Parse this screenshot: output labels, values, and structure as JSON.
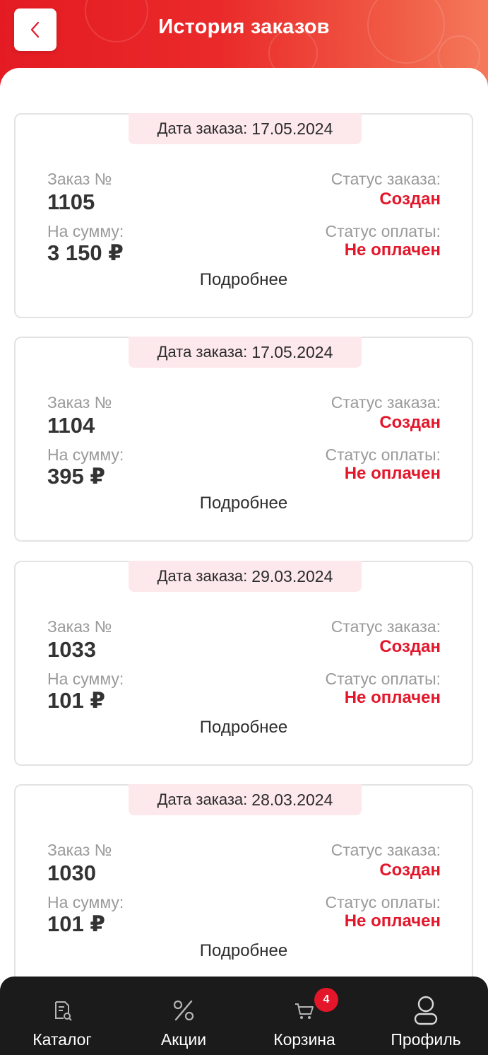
{
  "header": {
    "title": "История заказов"
  },
  "labels": {
    "date_prefix": "Дата заказа:",
    "order_no": "Заказ №",
    "amount": "На сумму:",
    "order_status": "Статус заказа:",
    "payment_status": "Статус оплаты:",
    "details": "Подробнее"
  },
  "orders": [
    {
      "date": "17.05.2024",
      "number": "1105",
      "amount": "3 150 ₽",
      "status": "Создан",
      "payment": "Не оплачен"
    },
    {
      "date": "17.05.2024",
      "number": "1104",
      "amount": "395 ₽",
      "status": "Создан",
      "payment": "Не оплачен"
    },
    {
      "date": "29.03.2024",
      "number": "1033",
      "amount": "101 ₽",
      "status": "Создан",
      "payment": "Не оплачен"
    },
    {
      "date": "28.03.2024",
      "number": "1030",
      "amount": "101 ₽",
      "status": "Создан",
      "payment": "Не оплачен"
    }
  ],
  "tabbar": {
    "items": [
      {
        "label": "Каталог",
        "icon": "catalog-icon"
      },
      {
        "label": "Акции",
        "icon": "percent-icon"
      },
      {
        "label": "Корзина",
        "icon": "cart-icon",
        "badge": "4"
      },
      {
        "label": "Профиль",
        "icon": "profile-icon"
      }
    ]
  },
  "colors": {
    "brand": "#e3162a",
    "tabbar": "#1b1b1b",
    "date_pill": "#fde8ec"
  }
}
